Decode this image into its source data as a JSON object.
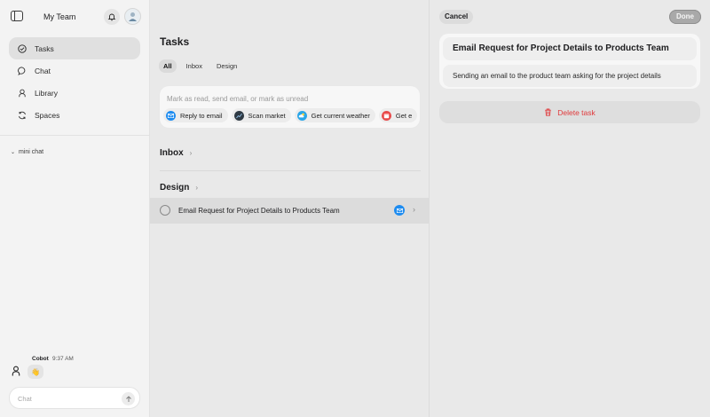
{
  "sidebar": {
    "team_name": "My Team",
    "nav": [
      {
        "label": "Tasks",
        "icon": "check-circle-icon",
        "active": true
      },
      {
        "label": "Chat",
        "icon": "chat-bubble-icon",
        "active": false
      },
      {
        "label": "Library",
        "icon": "person-icon",
        "active": false
      },
      {
        "label": "Spaces",
        "icon": "spaces-icon",
        "active": false
      }
    ],
    "mini_chat_label": "mini chat",
    "chat_message": {
      "sender": "Cobot",
      "time": "9:37 AM",
      "content": "👋"
    },
    "chat_placeholder": "Chat"
  },
  "tasks": {
    "title": "Tasks",
    "filters": [
      "All",
      "Inbox",
      "Design"
    ],
    "active_filter": "All",
    "command_placeholder": "Mark as read, send email, or mark as unread",
    "quick_actions": [
      {
        "label": "Reply to email",
        "icon": "mail-icon",
        "color": "#1e8cf0"
      },
      {
        "label": "Scan market",
        "icon": "market-icon",
        "color": "#2f3a44"
      },
      {
        "label": "Get current weather",
        "icon": "weather-icon",
        "color": "#2aa6e8"
      },
      {
        "label": "Get e",
        "icon": "calendar-icon",
        "color": "#e84a4a"
      }
    ],
    "sections": [
      {
        "name": "Inbox"
      },
      {
        "name": "Design"
      }
    ],
    "task_item": {
      "title": "Email Request for Project Details to Products Team",
      "icon": "mail-icon"
    }
  },
  "detail": {
    "cancel_label": "Cancel",
    "done_label": "Done",
    "title": "Email Request for Project Details to Products Team",
    "description": "Sending an email to the product team asking for the project details",
    "delete_label": "Delete task"
  },
  "colors": {
    "accent_mail": "#1e8cf0",
    "danger": "#e0393b"
  }
}
